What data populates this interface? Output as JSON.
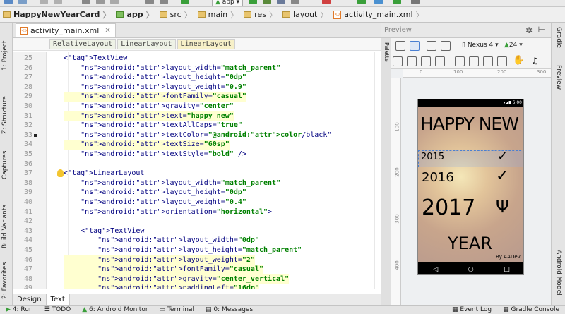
{
  "toolbar": {
    "run_config": "app"
  },
  "breadcrumb": {
    "items": [
      "HappyNewYearCard",
      "app",
      "src",
      "main",
      "res",
      "layout",
      "activity_main.xml"
    ]
  },
  "left_tabs": [
    "1: Project",
    "Z: Structure",
    "Captures",
    "Build Variants",
    "2: Favorites"
  ],
  "editor": {
    "tab_label": "activity_main.xml",
    "tree": [
      "RelativeLayout",
      "LinearLayout",
      "LinearLayout"
    ],
    "bottom_tabs": [
      "Design",
      "Text"
    ],
    "lines": [
      {
        "n": "25",
        "t": "        <TextView"
      },
      {
        "n": "26",
        "t": "            android:layout_width=\"match_parent\""
      },
      {
        "n": "27",
        "t": "            android:layout_height=\"0dp\""
      },
      {
        "n": "28",
        "t": "            android:layout_weight=\"0.9\""
      },
      {
        "n": "29",
        "t": "            android:fontFamily=\"casual\""
      },
      {
        "n": "30",
        "t": "            android:gravity=\"center\""
      },
      {
        "n": "31",
        "t": "            android:text=\"happy new\""
      },
      {
        "n": "32",
        "t": "            android:textAllCaps=\"true\""
      },
      {
        "n": "33",
        "t": "            android:textColor=\"@android:color/black\""
      },
      {
        "n": "34",
        "t": "            android:textSize=\"60sp\""
      },
      {
        "n": "35",
        "t": "            android:textStyle=\"bold\" />"
      },
      {
        "n": "36",
        "t": ""
      },
      {
        "n": "37",
        "t": "        <LinearLayout"
      },
      {
        "n": "38",
        "t": "            android:layout_width=\"match_parent\""
      },
      {
        "n": "39",
        "t": "            android:layout_height=\"0dp\""
      },
      {
        "n": "40",
        "t": "            android:layout_weight=\"0.4\""
      },
      {
        "n": "41",
        "t": "            android:orientation=\"horizontal\">"
      },
      {
        "n": "42",
        "t": ""
      },
      {
        "n": "43",
        "t": "            <TextView"
      },
      {
        "n": "44",
        "t": "                android:layout_width=\"0dp\""
      },
      {
        "n": "45",
        "t": "                android:layout_height=\"match_parent\""
      },
      {
        "n": "46",
        "t": "                android:layout_weight=\"2\""
      },
      {
        "n": "47",
        "t": "                android:fontFamily=\"casual\""
      },
      {
        "n": "48",
        "t": "                android:gravity=\"center_vertical\""
      },
      {
        "n": "49",
        "t": "                android:paddingLeft=\"16dp\""
      }
    ],
    "highlighted": [
      "29",
      "31",
      "34",
      "46",
      "47",
      "48",
      "49"
    ]
  },
  "preview": {
    "title": "Preview",
    "device": "Nexus 4",
    "api": "24",
    "ruler_h": [
      "0",
      "100",
      "200",
      "300"
    ],
    "ruler_v": [
      "100",
      "200",
      "300",
      "400"
    ],
    "phone": {
      "time": "6:00",
      "line1": "HAPPY NEW",
      "y2015": "2015",
      "y2016": "2016",
      "y2017": "2017",
      "year": "YEAR",
      "credit": "By AADev"
    }
  },
  "right_tabs": [
    "Gradle",
    "Preview",
    "Android Model"
  ],
  "status_tabs": [
    "4: Run",
    "TODO",
    "6: Android Monitor",
    "Terminal",
    "0: Messages",
    "Event Log",
    "Gradle Console"
  ],
  "colors": {
    "accent_green": "#3a9f3a",
    "tag": "#000080",
    "attr": "#660e7a",
    "value": "#008000",
    "highlight": "#ffffd0"
  }
}
